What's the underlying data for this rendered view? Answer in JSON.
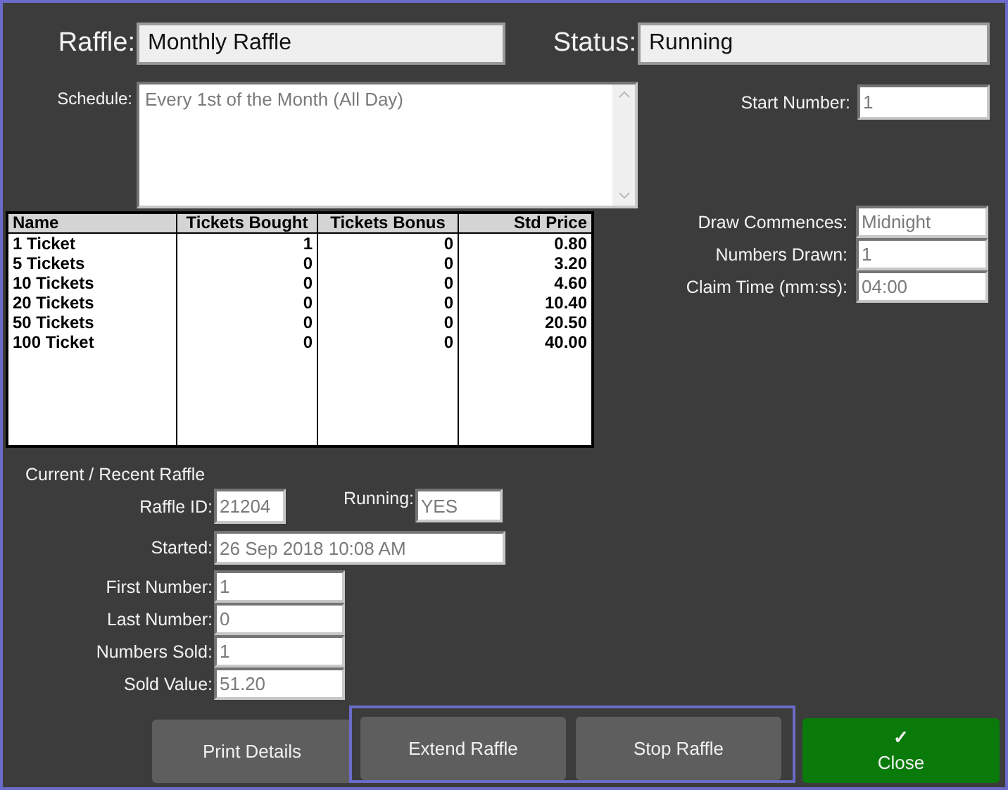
{
  "raffle": {
    "label": "Raffle:",
    "value": "Monthly Raffle"
  },
  "status": {
    "label": "Status:",
    "value": "Running"
  },
  "schedule": {
    "label": "Schedule:",
    "value": "Every 1st of the Month (All Day)"
  },
  "start_number": {
    "label": "Start Number:",
    "value": "1"
  },
  "draw_settings": [
    {
      "label": "Draw Commences:",
      "value": "Midnight"
    },
    {
      "label": "Numbers Drawn:",
      "value": "1"
    },
    {
      "label": "Claim Time (mm:ss):",
      "value": "04:00"
    }
  ],
  "table": {
    "columns": [
      "Name",
      "Tickets Bought",
      "Tickets Bonus",
      "Std Price"
    ],
    "rows": [
      [
        "1 Ticket",
        "1",
        "0",
        "0.80"
      ],
      [
        "5 Tickets",
        "0",
        "0",
        "3.20"
      ],
      [
        "10 Tickets",
        "0",
        "0",
        "4.60"
      ],
      [
        "20 Tickets",
        "0",
        "0",
        "10.40"
      ],
      [
        "50 Tickets",
        "0",
        "0",
        "20.50"
      ],
      [
        "100 Ticket",
        "0",
        "0",
        "40.00"
      ]
    ]
  },
  "current_raffle": {
    "title": "Current / Recent Raffle",
    "raffle_id": {
      "label": "Raffle ID:",
      "value": "21204"
    },
    "running": {
      "label": "Running:",
      "value": "YES"
    },
    "started": {
      "label": "Started:",
      "value": "26 Sep 2018 10:08 AM"
    },
    "numbers": [
      {
        "label": "First Number:",
        "value": "1"
      },
      {
        "label": "Last Number:",
        "value": "0"
      },
      {
        "label": "Numbers Sold:",
        "value": "1"
      },
      {
        "label": "Sold Value:",
        "value": "51.20"
      }
    ]
  },
  "buttons": [
    {
      "label": "Print Details",
      "kind": "plain",
      "highlighted": false
    },
    {
      "label": "Extend Raffle",
      "kind": "plain",
      "highlighted": true
    },
    {
      "label": "Stop Raffle",
      "kind": "plain",
      "highlighted": true
    },
    {
      "label": "Close",
      "kind": "primary",
      "icon": "✓",
      "highlighted": false
    }
  ]
}
